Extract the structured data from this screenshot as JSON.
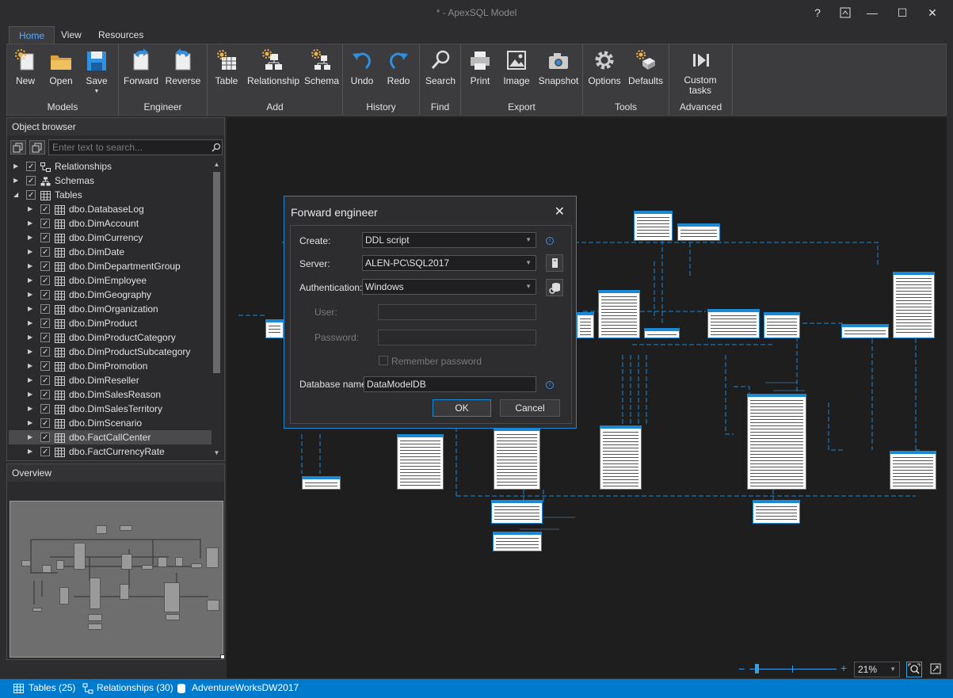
{
  "window": {
    "title": "* - ApexSQL Model",
    "help": "?",
    "restore_label": "⊼",
    "minimize": "—",
    "maximize": "☐",
    "close": "✕"
  },
  "tabs": [
    {
      "label": "Home",
      "active": true
    },
    {
      "label": "View"
    },
    {
      "label": "Resources"
    }
  ],
  "ribbon": {
    "groups": [
      {
        "label": "Models",
        "buttons": [
          {
            "label": "New",
            "icon": "new-icon"
          },
          {
            "label": "Open",
            "icon": "folder-icon"
          },
          {
            "label": "Save",
            "icon": "save-icon",
            "dropdown": true
          }
        ]
      },
      {
        "label": "Engineer",
        "buttons": [
          {
            "label": "Forward",
            "icon": "forward-engineer-icon"
          },
          {
            "label": "Reverse",
            "icon": "reverse-engineer-icon"
          }
        ]
      },
      {
        "label": "Add",
        "buttons": [
          {
            "label": "Table",
            "icon": "add-table-icon"
          },
          {
            "label": "Relationship",
            "icon": "add-relationship-icon"
          },
          {
            "label": "Schema",
            "icon": "add-schema-icon"
          }
        ]
      },
      {
        "label": "History",
        "buttons": [
          {
            "label": "Undo",
            "icon": "undo-icon"
          },
          {
            "label": "Redo",
            "icon": "redo-icon"
          }
        ]
      },
      {
        "label": "Find",
        "buttons": [
          {
            "label": "Search",
            "icon": "search-icon"
          }
        ]
      },
      {
        "label": "Export",
        "buttons": [
          {
            "label": "Print",
            "icon": "print-icon"
          },
          {
            "label": "Image",
            "icon": "image-icon"
          },
          {
            "label": "Snapshot",
            "icon": "snapshot-icon"
          }
        ]
      },
      {
        "label": "Tools",
        "buttons": [
          {
            "label": "Options",
            "icon": "gear-icon"
          },
          {
            "label": "Defaults",
            "icon": "defaults-icon"
          }
        ]
      },
      {
        "label": "Advanced",
        "buttons": [
          {
            "label": "Custom",
            "label2": "tasks",
            "icon": "custom-tasks-icon",
            "dropdown": true
          }
        ]
      }
    ]
  },
  "object_browser": {
    "title": "Object browser",
    "search_placeholder": "Enter text to search...",
    "items": [
      {
        "label": "Relationships",
        "level": 0,
        "icon": "relationship-icon"
      },
      {
        "label": "Schemas",
        "level": 0,
        "icon": "schema-icon"
      },
      {
        "label": "Tables",
        "level": 0,
        "icon": "table-icon",
        "expanded": true
      },
      {
        "label": "dbo.DatabaseLog",
        "level": 1
      },
      {
        "label": "dbo.DimAccount",
        "level": 1
      },
      {
        "label": "dbo.DimCurrency",
        "level": 1
      },
      {
        "label": "dbo.DimDate",
        "level": 1
      },
      {
        "label": "dbo.DimDepartmentGroup",
        "level": 1
      },
      {
        "label": "dbo.DimEmployee",
        "level": 1
      },
      {
        "label": "dbo.DimGeography",
        "level": 1
      },
      {
        "label": "dbo.DimOrganization",
        "level": 1
      },
      {
        "label": "dbo.DimProduct",
        "level": 1
      },
      {
        "label": "dbo.DimProductCategory",
        "level": 1
      },
      {
        "label": "dbo.DimProductSubcategory",
        "level": 1
      },
      {
        "label": "dbo.DimPromotion",
        "level": 1
      },
      {
        "label": "dbo.DimReseller",
        "level": 1
      },
      {
        "label": "dbo.DimSalesReason",
        "level": 1
      },
      {
        "label": "dbo.DimSalesTerritory",
        "level": 1
      },
      {
        "label": "dbo.DimScenario",
        "level": 1
      },
      {
        "label": "dbo.FactCallCenter",
        "level": 1,
        "selected": true
      },
      {
        "label": "dbo.FactCurrencyRate",
        "level": 1
      }
    ]
  },
  "overview": {
    "title": "Overview"
  },
  "dialog": {
    "title": "Forward engineer",
    "close": "✕",
    "create_label": "Create:",
    "create_value": "DDL script",
    "server_label": "Server:",
    "server_value": "ALEN-PC\\SQL2017",
    "auth_label": "Authentication:",
    "auth_value": "Windows",
    "user_label": "User:",
    "password_label": "Password:",
    "remember_label": "Remember password",
    "dbname_label": "Database name:",
    "dbname_value": "DataModelDB",
    "ok_label": "OK",
    "cancel_label": "Cancel"
  },
  "statusbar": {
    "tables": "Tables (25)",
    "relationships": "Relationships (30)",
    "database": "AdventureWorksDW2017"
  },
  "zoom": {
    "minus": "−",
    "plus": "+",
    "value": "21%",
    "level_percent": 21
  },
  "colors": {
    "accent": "#1b88d6",
    "statusbar": "#007acc"
  }
}
